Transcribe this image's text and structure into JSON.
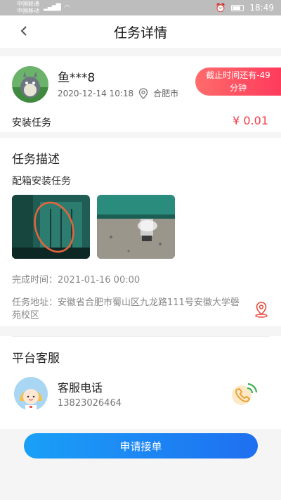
{
  "status_bar": {
    "carrier1": "中国联通",
    "carrier2": "中国移动",
    "time": "18:49"
  },
  "nav": {
    "title": "任务详情"
  },
  "task": {
    "username": "鱼***8",
    "date": "2020-12-14 10:18",
    "city": "合肥市",
    "deadline_line1": "截止时间还有-49",
    "deadline_line2": "分钟",
    "name": "安装任务",
    "price": "¥ 0.01"
  },
  "description": {
    "title": "任务描述",
    "text": "配箱安装任务",
    "completion_time": "完成时间：2021-01-16 00:00",
    "address": "任务地址：安徽省合肥市蜀山区九龙路111号安徽大学磬苑校区"
  },
  "service": {
    "title": "平台客服",
    "label": "客服电话",
    "phone": "13823026464"
  },
  "action": {
    "apply_label": "申请接单"
  }
}
